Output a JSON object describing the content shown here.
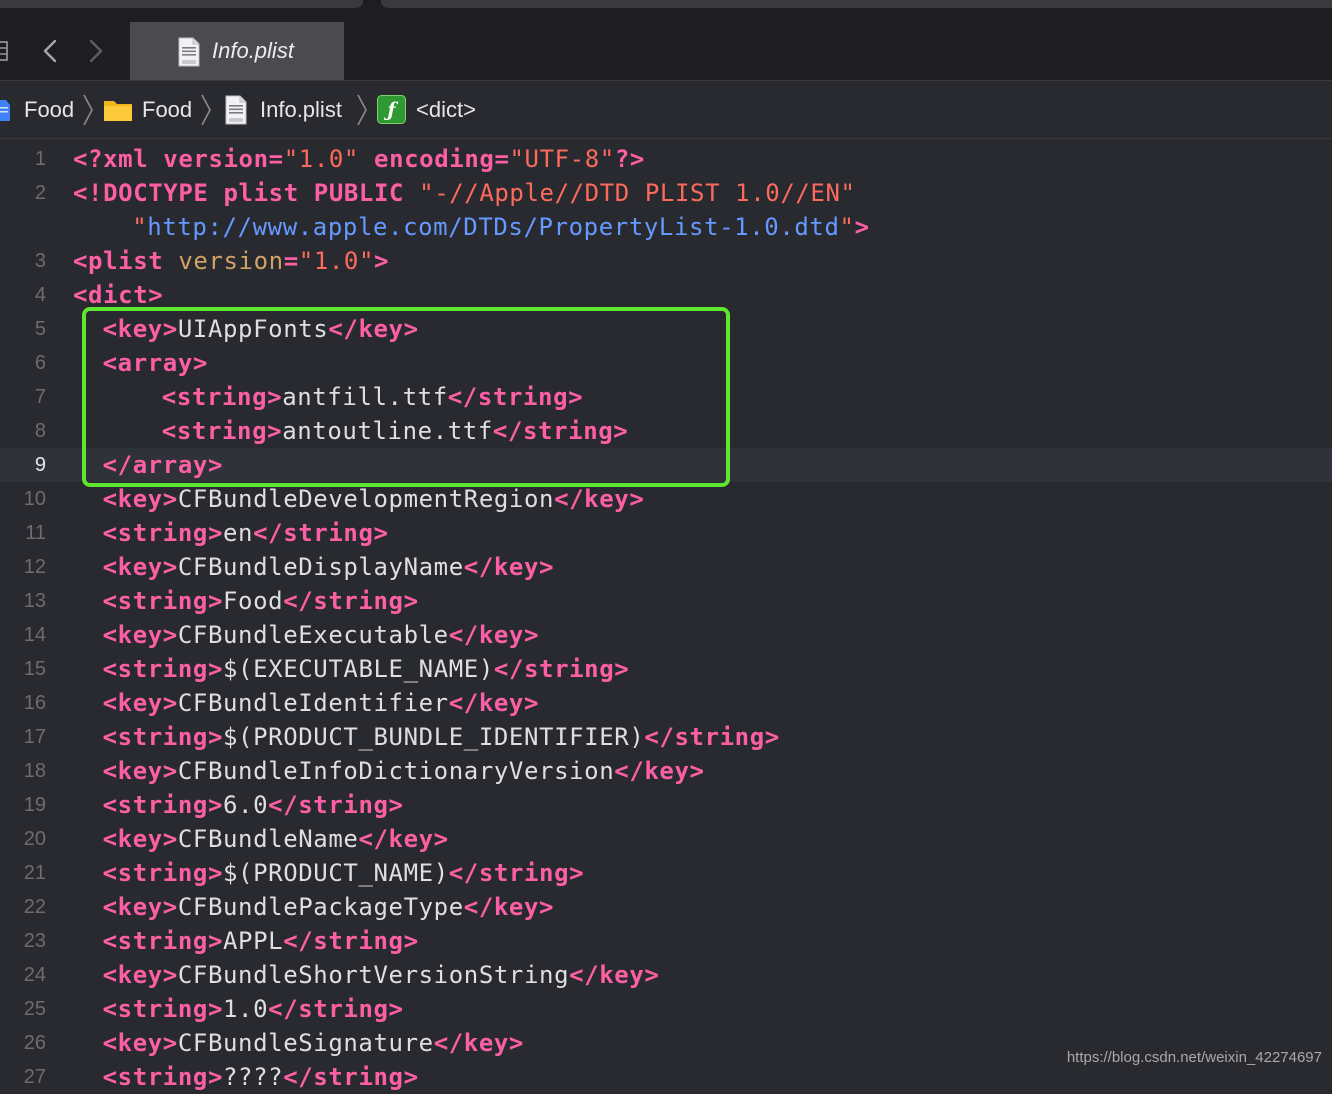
{
  "tab": {
    "title": "Info.plist"
  },
  "breadcrumb": [
    {
      "label": "Food",
      "icon": "project-icon"
    },
    {
      "label": "Food",
      "icon": "folder-icon"
    },
    {
      "label": "Info.plist",
      "icon": "plist-file-icon"
    },
    {
      "label": "<dict>",
      "icon": "dictionary-icon"
    }
  ],
  "current_line": 9,
  "editor_lines": [
    {
      "num": "1",
      "indent": 0,
      "tokens": [
        {
          "t": "tag",
          "v": "<?xml "
        },
        {
          "t": "tag",
          "v": "version"
        },
        {
          "t": "tag",
          "v": "="
        },
        {
          "t": "str",
          "v": "\"1.0\""
        },
        {
          "t": "text",
          "v": " "
        },
        {
          "t": "tag",
          "v": "encoding"
        },
        {
          "t": "tag",
          "v": "="
        },
        {
          "t": "str",
          "v": "\"UTF-8\""
        },
        {
          "t": "tag",
          "v": "?>"
        }
      ]
    },
    {
      "num": "2",
      "indent": 0,
      "tokens": [
        {
          "t": "tag",
          "v": "<!DOCTYPE plist PUBLIC "
        },
        {
          "t": "str",
          "v": "\"-//Apple//DTD PLIST 1.0//EN\""
        }
      ]
    },
    {
      "num": "",
      "indent": 4,
      "tokens": [
        {
          "t": "str",
          "v": "\""
        },
        {
          "t": "url",
          "v": "http://www.apple.com/DTDs/PropertyList-1.0.dtd"
        },
        {
          "t": "str",
          "v": "\""
        },
        {
          "t": "tag",
          "v": ">"
        }
      ]
    },
    {
      "num": "3",
      "indent": 0,
      "tokens": [
        {
          "t": "tag",
          "v": "<plist "
        },
        {
          "t": "attr",
          "v": "version"
        },
        {
          "t": "tag",
          "v": "="
        },
        {
          "t": "str",
          "v": "\"1.0\""
        },
        {
          "t": "tag",
          "v": ">"
        }
      ]
    },
    {
      "num": "4",
      "indent": 0,
      "tokens": [
        {
          "t": "tag",
          "v": "<dict>"
        }
      ]
    },
    {
      "num": "5",
      "indent": 2,
      "tokens": [
        {
          "t": "tag",
          "v": "<key>"
        },
        {
          "t": "text",
          "v": "UIAppFonts"
        },
        {
          "t": "tag",
          "v": "</key>"
        }
      ]
    },
    {
      "num": "6",
      "indent": 2,
      "tokens": [
        {
          "t": "tag",
          "v": "<array>"
        }
      ]
    },
    {
      "num": "7",
      "indent": 6,
      "tokens": [
        {
          "t": "tag",
          "v": "<string>"
        },
        {
          "t": "text",
          "v": "antfill.ttf"
        },
        {
          "t": "tag",
          "v": "</string>"
        }
      ]
    },
    {
      "num": "8",
      "indent": 6,
      "tokens": [
        {
          "t": "tag",
          "v": "<string>"
        },
        {
          "t": "text",
          "v": "antoutline.ttf"
        },
        {
          "t": "tag",
          "v": "</string>"
        }
      ]
    },
    {
      "num": "9",
      "indent": 2,
      "tokens": [
        {
          "t": "tag",
          "v": "</array>"
        }
      ]
    },
    {
      "num": "10",
      "indent": 2,
      "tokens": [
        {
          "t": "tag",
          "v": "<key>"
        },
        {
          "t": "text",
          "v": "CFBundleDevelopmentRegion"
        },
        {
          "t": "tag",
          "v": "</key>"
        }
      ]
    },
    {
      "num": "11",
      "indent": 2,
      "tokens": [
        {
          "t": "tag",
          "v": "<string>"
        },
        {
          "t": "text",
          "v": "en"
        },
        {
          "t": "tag",
          "v": "</string>"
        }
      ]
    },
    {
      "num": "12",
      "indent": 2,
      "tokens": [
        {
          "t": "tag",
          "v": "<key>"
        },
        {
          "t": "text",
          "v": "CFBundleDisplayName"
        },
        {
          "t": "tag",
          "v": "</key>"
        }
      ]
    },
    {
      "num": "13",
      "indent": 2,
      "tokens": [
        {
          "t": "tag",
          "v": "<string>"
        },
        {
          "t": "text",
          "v": "Food"
        },
        {
          "t": "tag",
          "v": "</string>"
        }
      ]
    },
    {
      "num": "14",
      "indent": 2,
      "tokens": [
        {
          "t": "tag",
          "v": "<key>"
        },
        {
          "t": "text",
          "v": "CFBundleExecutable"
        },
        {
          "t": "tag",
          "v": "</key>"
        }
      ]
    },
    {
      "num": "15",
      "indent": 2,
      "tokens": [
        {
          "t": "tag",
          "v": "<string>"
        },
        {
          "t": "text",
          "v": "$(EXECUTABLE_NAME)"
        },
        {
          "t": "tag",
          "v": "</string>"
        }
      ]
    },
    {
      "num": "16",
      "indent": 2,
      "tokens": [
        {
          "t": "tag",
          "v": "<key>"
        },
        {
          "t": "text",
          "v": "CFBundleIdentifier"
        },
        {
          "t": "tag",
          "v": "</key>"
        }
      ]
    },
    {
      "num": "17",
      "indent": 2,
      "tokens": [
        {
          "t": "tag",
          "v": "<string>"
        },
        {
          "t": "text",
          "v": "$(PRODUCT_BUNDLE_IDENTIFIER)"
        },
        {
          "t": "tag",
          "v": "</string>"
        }
      ]
    },
    {
      "num": "18",
      "indent": 2,
      "tokens": [
        {
          "t": "tag",
          "v": "<key>"
        },
        {
          "t": "text",
          "v": "CFBundleInfoDictionaryVersion"
        },
        {
          "t": "tag",
          "v": "</key>"
        }
      ]
    },
    {
      "num": "19",
      "indent": 2,
      "tokens": [
        {
          "t": "tag",
          "v": "<string>"
        },
        {
          "t": "text",
          "v": "6.0"
        },
        {
          "t": "tag",
          "v": "</string>"
        }
      ]
    },
    {
      "num": "20",
      "indent": 2,
      "tokens": [
        {
          "t": "tag",
          "v": "<key>"
        },
        {
          "t": "text",
          "v": "CFBundleName"
        },
        {
          "t": "tag",
          "v": "</key>"
        }
      ]
    },
    {
      "num": "21",
      "indent": 2,
      "tokens": [
        {
          "t": "tag",
          "v": "<string>"
        },
        {
          "t": "text",
          "v": "$(PRODUCT_NAME)"
        },
        {
          "t": "tag",
          "v": "</string>"
        }
      ]
    },
    {
      "num": "22",
      "indent": 2,
      "tokens": [
        {
          "t": "tag",
          "v": "<key>"
        },
        {
          "t": "text",
          "v": "CFBundlePackageType"
        },
        {
          "t": "tag",
          "v": "</key>"
        }
      ]
    },
    {
      "num": "23",
      "indent": 2,
      "tokens": [
        {
          "t": "tag",
          "v": "<string>"
        },
        {
          "t": "text",
          "v": "APPL"
        },
        {
          "t": "tag",
          "v": "</string>"
        }
      ]
    },
    {
      "num": "24",
      "indent": 2,
      "tokens": [
        {
          "t": "tag",
          "v": "<key>"
        },
        {
          "t": "text",
          "v": "CFBundleShortVersionString"
        },
        {
          "t": "tag",
          "v": "</key>"
        }
      ]
    },
    {
      "num": "25",
      "indent": 2,
      "tokens": [
        {
          "t": "tag",
          "v": "<string>"
        },
        {
          "t": "text",
          "v": "1.0"
        },
        {
          "t": "tag",
          "v": "</string>"
        }
      ]
    },
    {
      "num": "26",
      "indent": 2,
      "tokens": [
        {
          "t": "tag",
          "v": "<key>"
        },
        {
          "t": "text",
          "v": "CFBundleSignature"
        },
        {
          "t": "tag",
          "v": "</key>"
        }
      ]
    },
    {
      "num": "27",
      "indent": 2,
      "tokens": [
        {
          "t": "tag",
          "v": "<string>"
        },
        {
          "t": "text",
          "v": "????"
        },
        {
          "t": "tag",
          "v": "</string>"
        }
      ]
    }
  ],
  "colors": {
    "tag": "#fc5fa3",
    "attr": "#d0a264",
    "string": "#fc6a5d",
    "url": "#6699ff",
    "text": "#dfdfe0",
    "highlight_box": "#5fe62e",
    "background": "#292a30"
  },
  "watermark": "https://blog.csdn.net/weixin_42274697"
}
